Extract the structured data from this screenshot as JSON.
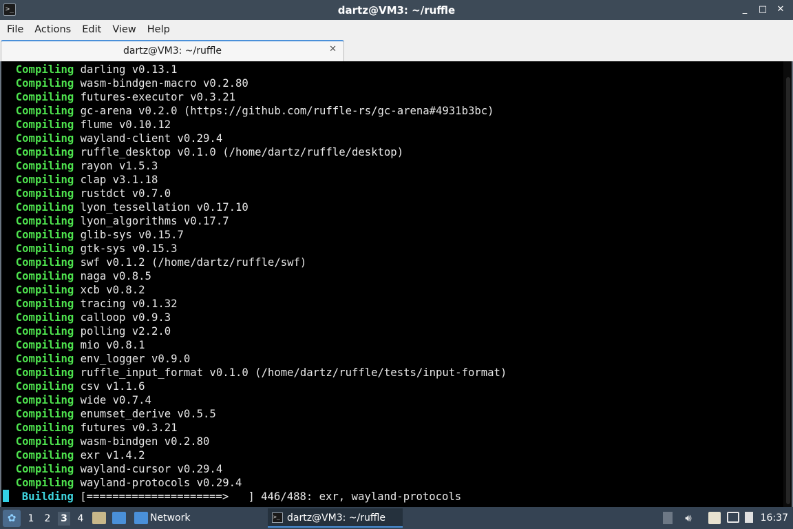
{
  "window": {
    "title": "dartz@VM3: ~/ruffle",
    "app_icon_glyph": ">_",
    "controls": {
      "minimize": "_",
      "maximize": "□",
      "close": "✕"
    }
  },
  "menu": [
    "File",
    "Actions",
    "Edit",
    "View",
    "Help"
  ],
  "tab": {
    "label": "dartz@VM3: ~/ruffle",
    "close_glyph": "✕"
  },
  "terminal": {
    "lines": [
      {
        "verb": "Compiling",
        "text": " darling v0.13.1"
      },
      {
        "verb": "Compiling",
        "text": " wasm-bindgen-macro v0.2.80"
      },
      {
        "verb": "Compiling",
        "text": " futures-executor v0.3.21"
      },
      {
        "verb": "Compiling",
        "text": " gc-arena v0.2.0 (https://github.com/ruffle-rs/gc-arena#4931b3bc)"
      },
      {
        "verb": "Compiling",
        "text": " flume v0.10.12"
      },
      {
        "verb": "Compiling",
        "text": " wayland-client v0.29.4"
      },
      {
        "verb": "Compiling",
        "text": " ruffle_desktop v0.1.0 (/home/dartz/ruffle/desktop)"
      },
      {
        "verb": "Compiling",
        "text": " rayon v1.5.3"
      },
      {
        "verb": "Compiling",
        "text": " clap v3.1.18"
      },
      {
        "verb": "Compiling",
        "text": " rustdct v0.7.0"
      },
      {
        "verb": "Compiling",
        "text": " lyon_tessellation v0.17.10"
      },
      {
        "verb": "Compiling",
        "text": " lyon_algorithms v0.17.7"
      },
      {
        "verb": "Compiling",
        "text": " glib-sys v0.15.7"
      },
      {
        "verb": "Compiling",
        "text": " gtk-sys v0.15.3"
      },
      {
        "verb": "Compiling",
        "text": " swf v0.1.2 (/home/dartz/ruffle/swf)"
      },
      {
        "verb": "Compiling",
        "text": " naga v0.8.5"
      },
      {
        "verb": "Compiling",
        "text": " xcb v0.8.2"
      },
      {
        "verb": "Compiling",
        "text": " tracing v0.1.32"
      },
      {
        "verb": "Compiling",
        "text": " calloop v0.9.3"
      },
      {
        "verb": "Compiling",
        "text": " polling v2.2.0"
      },
      {
        "verb": "Compiling",
        "text": " mio v0.8.1"
      },
      {
        "verb": "Compiling",
        "text": " env_logger v0.9.0"
      },
      {
        "verb": "Compiling",
        "text": " ruffle_input_format v0.1.0 (/home/dartz/ruffle/tests/input-format)"
      },
      {
        "verb": "Compiling",
        "text": " csv v1.1.6"
      },
      {
        "verb": "Compiling",
        "text": " wide v0.7.4"
      },
      {
        "verb": "Compiling",
        "text": " enumset_derive v0.5.5"
      },
      {
        "verb": "Compiling",
        "text": " futures v0.3.21"
      },
      {
        "verb": "Compiling",
        "text": " wasm-bindgen v0.2.80"
      },
      {
        "verb": "Compiling",
        "text": " exr v1.4.2"
      },
      {
        "verb": "Compiling",
        "text": " wayland-cursor v0.29.4"
      },
      {
        "verb": "Compiling",
        "text": " wayland-protocols v0.29.4"
      }
    ],
    "status_verb": "Building",
    "status_text": " [=====================>   ] 446/488: exr, wayland-protocols",
    "colors": {
      "compiling": "#4ee34e",
      "building": "#3fd6e0",
      "text": "#e8e8e8",
      "background": "#000000"
    }
  },
  "taskbar": {
    "start_icon": "lxqt-menu-icon",
    "workspaces": [
      "1",
      "2",
      "3",
      "4"
    ],
    "active_workspace": "3",
    "quicklaunch": [
      "file-manager-icon",
      "show-desktop-icon"
    ],
    "folder_label": "Network",
    "task_label": "dartz@VM3: ~/ruffle",
    "tray": [
      "eject-icon",
      "volume-icon",
      "clipboard-icon",
      "network-icon",
      "update-notifier-icon"
    ],
    "clock": "16:37"
  }
}
